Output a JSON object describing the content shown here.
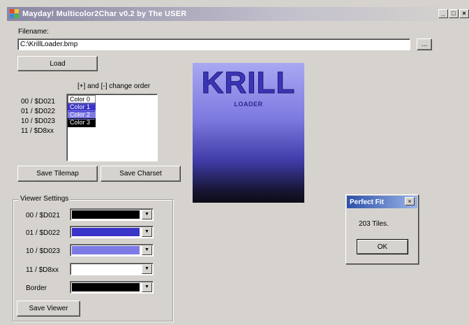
{
  "window": {
    "title": "Mayday! Multicolor2Char v0.2 by The USER",
    "minimize": "_",
    "maximize": "□",
    "close": "×"
  },
  "filename": {
    "label": "Filename:",
    "value": "C:\\KrillLoader.bmp",
    "browse_label": "..."
  },
  "load_label": "Load",
  "order_hint": "[+] and [-] change order",
  "color_labels": [
    "00 / $D021",
    "01 / $D022",
    "10 / $D023",
    "11 / $D8xx"
  ],
  "color_list": [
    {
      "label": "Color 0",
      "bg": "#ffffff",
      "fg": "#000000",
      "border": "#808080"
    },
    {
      "label": "Color 1",
      "bg": "#3a35c8",
      "fg": "#ffffff",
      "border": "#3a35c8"
    },
    {
      "label": "Color 2",
      "bg": "#7d7ae6",
      "fg": "#ffffff",
      "border": "#7d7ae6"
    },
    {
      "label": "Color 3",
      "bg": "#000000",
      "fg": "#ffffff",
      "border": "#000000"
    }
  ],
  "save_tilemap_label": "Save Tilemap",
  "save_charset_label": "Save Charset",
  "viewer": {
    "title": "Viewer Settings",
    "rows": [
      {
        "label": "00 / $D021",
        "color": "#000000"
      },
      {
        "label": "01 / $D022",
        "color": "#3a35c8"
      },
      {
        "label": "10 / $D023",
        "color": "#7d7ae6"
      },
      {
        "label": "11 / $D8xx",
        "color": "#ffffff"
      },
      {
        "label": "Border",
        "color": "#000000"
      }
    ],
    "save_label": "Save Viewer"
  },
  "preview": {
    "title": "KRILL",
    "subtitle": "LOADER"
  },
  "dialog": {
    "title": "Perfect Fit",
    "close": "×",
    "message": "203 Tiles.",
    "ok_label": "OK"
  },
  "colors": {
    "window_bg": "#d6d3ce",
    "title_gradient_start": "#8a87a3",
    "dialog_title_start": "#2c50a8"
  }
}
